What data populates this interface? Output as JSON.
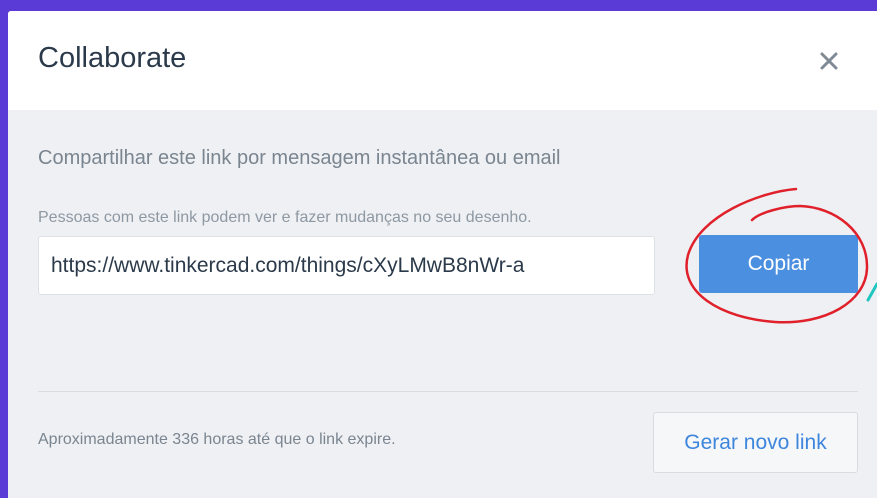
{
  "dialog": {
    "title": "Collaborate",
    "close_icon": "close-icon",
    "subtitle": "Compartilhar este link por mensagem instantânea ou email",
    "hint": "Pessoas com este link podem ver e fazer mudanças no seu desenho.",
    "link_value": "https://www.tinkercad.com/things/cXyLMwB8nWr-a",
    "copy_label": "Copiar",
    "expire_text": "Aproximadamente 336 horas até que o link expire.",
    "regenerate_label": "Gerar novo link"
  },
  "colors": {
    "background": "#5b3bd6",
    "accent": "#4a8fe0",
    "annotation_red": "#e0202a",
    "annotation_teal": "#1ec6c0"
  }
}
